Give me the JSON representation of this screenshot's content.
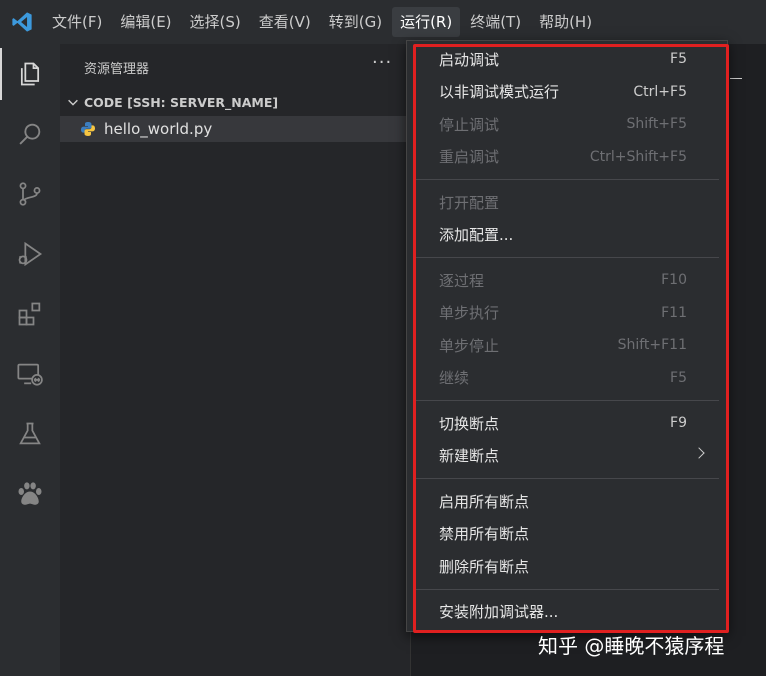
{
  "menubar": {
    "items": [
      "文件(F)",
      "编辑(E)",
      "选择(S)",
      "查看(V)",
      "转到(G)",
      "运行(R)",
      "终端(T)",
      "帮助(H)"
    ],
    "active_index": 5
  },
  "activitybar": {
    "icons": [
      "explorer-icon",
      "search-icon",
      "source-control-icon",
      "run-debug-icon",
      "extensions-icon",
      "remote-explorer-icon",
      "testing-icon",
      "paw-icon"
    ]
  },
  "sidebar": {
    "title": "资源管理器",
    "more": "···",
    "folder": "CODE [SSH: SERVER_NAME]",
    "file": "hello_world.py"
  },
  "run_menu": {
    "groups": [
      [
        {
          "label": "启动调试",
          "shortcut": "F5",
          "enabled": true
        },
        {
          "label": "以非调试模式运行",
          "shortcut": "Ctrl+F5",
          "enabled": true
        },
        {
          "label": "停止调试",
          "shortcut": "Shift+F5",
          "enabled": false
        },
        {
          "label": "重启调试",
          "shortcut": "Ctrl+Shift+F5",
          "enabled": false
        }
      ],
      [
        {
          "label": "打开配置",
          "shortcut": "",
          "enabled": false
        },
        {
          "label": "添加配置...",
          "shortcut": "",
          "enabled": true
        }
      ],
      [
        {
          "label": "逐过程",
          "shortcut": "F10",
          "enabled": false
        },
        {
          "label": "单步执行",
          "shortcut": "F11",
          "enabled": false
        },
        {
          "label": "单步停止",
          "shortcut": "Shift+F11",
          "enabled": false
        },
        {
          "label": "继续",
          "shortcut": "F5",
          "enabled": false
        }
      ],
      [
        {
          "label": "切换断点",
          "shortcut": "F9",
          "enabled": true
        },
        {
          "label": "新建断点",
          "shortcut": "",
          "enabled": true,
          "submenu": true
        }
      ],
      [
        {
          "label": "启用所有断点",
          "shortcut": "",
          "enabled": true
        },
        {
          "label": "禁用所有断点",
          "shortcut": "",
          "enabled": true
        },
        {
          "label": "删除所有断点",
          "shortcut": "",
          "enabled": true
        }
      ],
      [
        {
          "label": "安装附加调试器...",
          "shortcut": "",
          "enabled": true
        }
      ]
    ]
  },
  "watermark": "知乎 @睡晚不猿序程",
  "colors": {
    "highlight": "#e02020",
    "vscode_blue": "#3c99dc",
    "python_blue": "#3c7ebf",
    "python_yellow": "#f5c542"
  }
}
